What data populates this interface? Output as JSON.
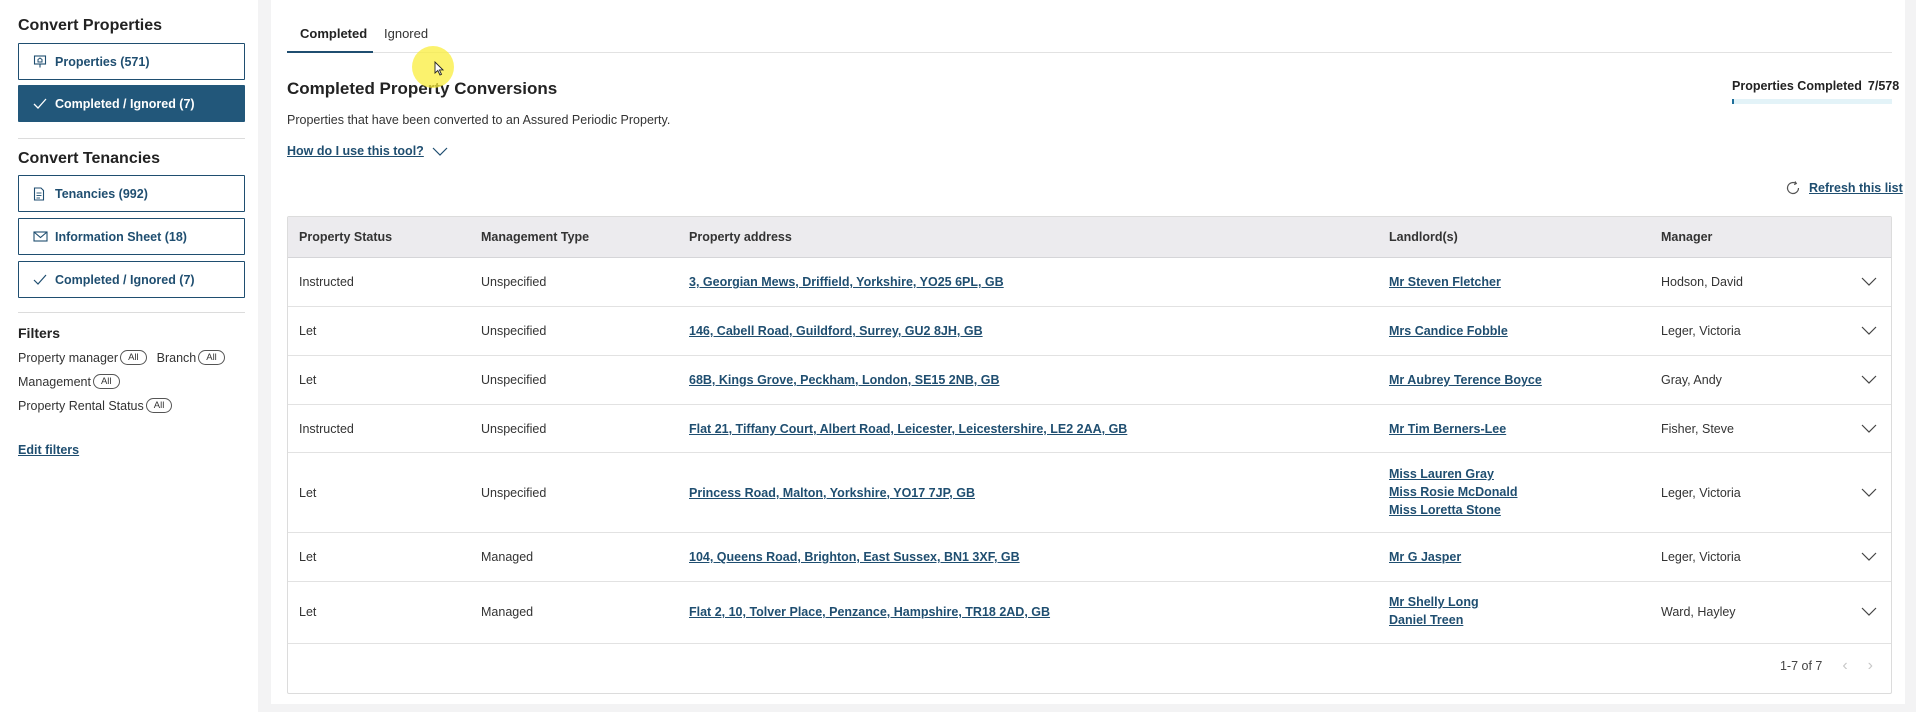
{
  "sidebar": {
    "convert_properties_heading": "Convert Properties",
    "properties_button": "Properties (571)",
    "completed_ignored_properties_button": "Completed / Ignored (7)",
    "convert_tenancies_heading": "Convert Tenancies",
    "tenancies_button": "Tenancies (992)",
    "information_sheet_button": "Information Sheet (18)",
    "completed_ignored_tenancies_button": "Completed / Ignored (7)",
    "filters_heading": "Filters",
    "filters": [
      {
        "label": "Property manager",
        "value": "All"
      },
      {
        "label": "Branch",
        "value": "All"
      },
      {
        "label": "Management",
        "value": "All"
      },
      {
        "label": "Property Rental Status",
        "value": "All"
      }
    ],
    "edit_filters": "Edit filters"
  },
  "tabs": [
    {
      "label": "Completed",
      "active": true
    },
    {
      "label": "Ignored",
      "active": false
    }
  ],
  "main": {
    "title": "Completed Property Conversions",
    "subtitle": "Properties that have been converted to an Assured Periodic Property.",
    "how_to": "How do I use this tool?",
    "progress_label": "Properties Completed",
    "progress_count": "7/578",
    "progress_fraction": 0.0121,
    "refresh": "Refresh this list"
  },
  "table": {
    "columns": [
      "Property Status",
      "Management Type",
      "Property address",
      "Landlord(s)",
      "Manager"
    ],
    "rows": [
      {
        "status": "Instructed",
        "management": "Unspecified",
        "address": "3, Georgian Mews, Driffield, Yorkshire, YO25 6PL, GB",
        "landlords": [
          "Mr Steven Fletcher"
        ],
        "manager": "Hodson, David"
      },
      {
        "status": "Let",
        "management": "Unspecified",
        "address": "146, Cabell Road, Guildford, Surrey, GU2 8JH, GB",
        "landlords": [
          "Mrs Candice Fobble"
        ],
        "manager": "Leger, Victoria"
      },
      {
        "status": "Let",
        "management": "Unspecified",
        "address": "68B, Kings Grove, Peckham, London, SE15 2NB, GB",
        "landlords": [
          "Mr Aubrey Terence Boyce"
        ],
        "manager": "Gray, Andy"
      },
      {
        "status": "Instructed",
        "management": "Unspecified",
        "address": "Flat 21, Tiffany Court, Albert Road, Leicester, Leicestershire, LE2 2AA, GB",
        "landlords": [
          "Mr Tim Berners-Lee"
        ],
        "manager": "Fisher, Steve"
      },
      {
        "status": "Let",
        "management": "Unspecified",
        "address": "Princess Road, Malton, Yorkshire, YO17 7JP, GB",
        "landlords": [
          "Miss Lauren Gray",
          "Miss Rosie McDonald",
          "Miss Loretta Stone"
        ],
        "manager": "Leger, Victoria"
      },
      {
        "status": "Let",
        "management": "Managed",
        "address": "104, Queens Road, Brighton, East Sussex, BN1 3XF, GB",
        "landlords": [
          "Mr G Jasper"
        ],
        "manager": "Leger, Victoria"
      },
      {
        "status": "Let",
        "management": "Managed",
        "address": "Flat 2, 10, Tolver Place, Penzance, Hampshire, TR18 2AD, GB",
        "landlords": [
          "Mr Shelly Long",
          "Daniel Treen"
        ],
        "manager": "Ward, Hayley"
      }
    ],
    "pagination": "1-7 of 7"
  },
  "icons": {
    "properties": "property-board-icon",
    "completed": "check-icon",
    "tenancies": "document-icon",
    "information_sheet": "mail-icon",
    "how_to": "chevron-down-icon",
    "refresh": "refresh-icon",
    "row_expand": "chevron-down-icon",
    "prev": "chevron-left-icon",
    "next": "chevron-right-icon"
  },
  "colors": {
    "accent": "#1f4e70",
    "active_button": "#22577a",
    "progress_fill": "#1f6f9a",
    "header_bg": "#ecebee"
  }
}
